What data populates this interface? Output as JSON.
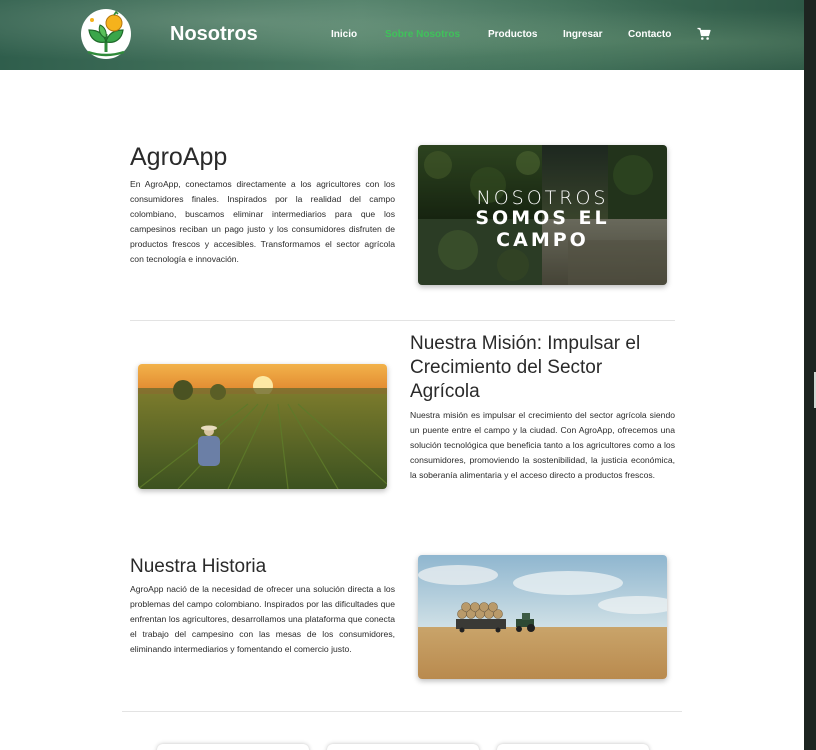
{
  "header": {
    "brand": "Nosotros",
    "nav": [
      {
        "label": "Inicio",
        "active": false
      },
      {
        "label": "Sobre Nosotros",
        "active": true
      },
      {
        "label": "Productos",
        "active": false
      },
      {
        "label": "Ingresar",
        "active": false
      },
      {
        "label": "Contacto",
        "active": false
      }
    ],
    "cart_icon": "shopping-cart-icon"
  },
  "intro": {
    "title": "AgroApp",
    "text": "En AgroApp, conectamos directamente a los agricultores con los consumidores finales. Inspirados por la realidad del campo colombiano, buscamos eliminar intermediarios para que los campesinos reciban un pago justo y los consumidores disfruten de productos frescos y accesibles. Transformamos el sector agrícola con tecnología e innovación.",
    "image_line1": "NOSOTROS",
    "image_line2": "SOMOS EL",
    "image_line3": "CAMPO"
  },
  "mission": {
    "title": "Nuestra Misión: Impulsar el Crecimiento del Sector Agrícola",
    "text": "Nuestra misión es impulsar el crecimiento del sector agrícola siendo un puente entre el campo y la ciudad. Con AgroApp, ofrecemos una solución tecnológica que beneficia tanto a los agricultores como a los consumidores, promoviendo la sostenibilidad, la justicia económica, la soberanía alimentaria y el acceso directo a productos frescos."
  },
  "history": {
    "title": "Nuestra Historia",
    "text": "AgroApp nació de la necesidad de ofrecer una solución directa a los problemas del campo colombiano. Inspirados por las dificultades que enfrentan los agricultores, desarrollamos una plataforma que conecta el trabajo del campesino con las mesas de los consumidores, eliminando intermediarios y fomentando el comercio justo."
  },
  "colors": {
    "accent": "#3fc25a",
    "header": "#3d6c57"
  }
}
